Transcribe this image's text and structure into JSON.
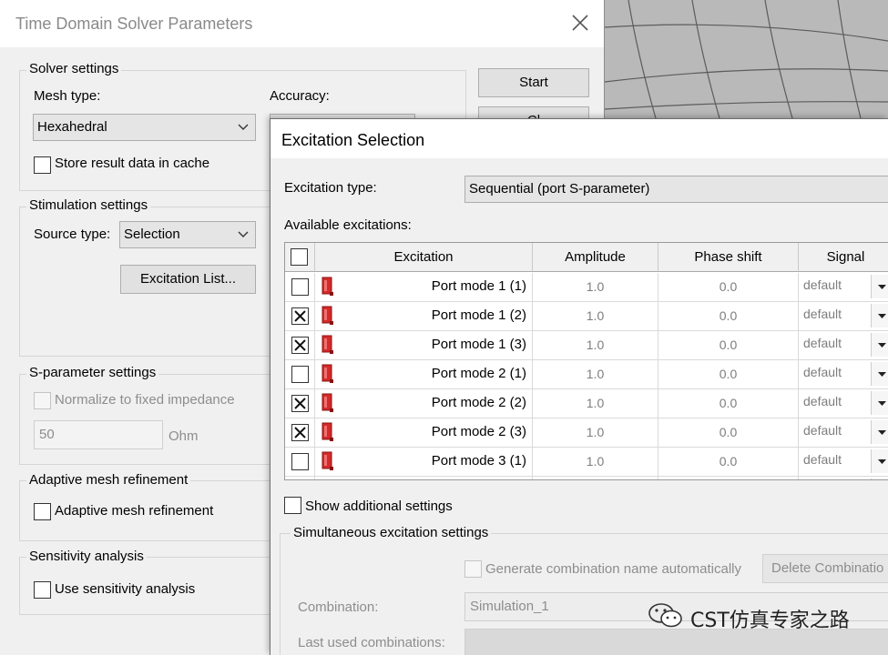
{
  "solver_dialog": {
    "title": "Time Domain Solver Parameters",
    "solver_settings": {
      "group_title": "Solver settings",
      "mesh_type_label": "Mesh type:",
      "mesh_type_value": "Hexahedral",
      "accuracy_label": "Accuracy:",
      "store_cache_label": "Store result data in cache",
      "store_cache_checked": false
    },
    "buttons": {
      "start": "Start",
      "second_partial": "Cl"
    },
    "stimulation_settings": {
      "group_title": "Stimulation settings",
      "source_type_label": "Source type:",
      "source_type_value": "Selection",
      "excitation_list_button": "Excitation List..."
    },
    "sparameter_settings": {
      "group_title": "S-parameter settings",
      "normalize_label": "Normalize to fixed impedance",
      "impedance_value": "50",
      "impedance_unit": "Ohm"
    },
    "adaptive_mesh": {
      "group_title": "Adaptive mesh refinement",
      "checkbox_label": "Adaptive mesh refinement"
    },
    "sensitivity": {
      "group_title": "Sensitivity analysis",
      "checkbox_label": "Use sensitivity analysis"
    }
  },
  "excitation_dialog": {
    "title": "Excitation Selection",
    "excitation_type_label": "Excitation type:",
    "excitation_type_value": "Sequential (port S-parameter)",
    "available_label": "Available excitations:",
    "columns": {
      "excitation": "Excitation",
      "amplitude": "Amplitude",
      "phase_shift": "Phase shift",
      "signal": "Signal"
    },
    "rows": [
      {
        "name": "Port mode 1 (1)",
        "checked": false,
        "amplitude": "1.0",
        "phase": "0.0",
        "signal": "default"
      },
      {
        "name": "Port mode 1 (2)",
        "checked": true,
        "amplitude": "1.0",
        "phase": "0.0",
        "signal": "default"
      },
      {
        "name": "Port mode 1 (3)",
        "checked": true,
        "amplitude": "1.0",
        "phase": "0.0",
        "signal": "default"
      },
      {
        "name": "Port mode 2 (1)",
        "checked": false,
        "amplitude": "1.0",
        "phase": "0.0",
        "signal": "default"
      },
      {
        "name": "Port mode 2 (2)",
        "checked": true,
        "amplitude": "1.0",
        "phase": "0.0",
        "signal": "default"
      },
      {
        "name": "Port mode 2 (3)",
        "checked": true,
        "amplitude": "1.0",
        "phase": "0.0",
        "signal": "default"
      },
      {
        "name": "Port mode 3 (1)",
        "checked": false,
        "amplitude": "1.0",
        "phase": "0.0",
        "signal": "default"
      }
    ],
    "partial_row_signal": "default",
    "show_additional_label": "Show additional settings",
    "simultaneous": {
      "group_title": "Simultaneous excitation settings",
      "generate_name_label": "Generate combination name automatically",
      "delete_button": "Delete Combinatio",
      "combination_label": "Combination:",
      "combination_value": "Simulation_1",
      "last_used_label": "Last used combinations:"
    }
  },
  "watermark": {
    "text": "CST仿真专家之路",
    "icon": "wechat-icon"
  },
  "colors": {
    "port_icon_red": "#d42a2a",
    "dialog_bg": "#f0f0f0",
    "disabled_text": "#8d8d8d"
  }
}
